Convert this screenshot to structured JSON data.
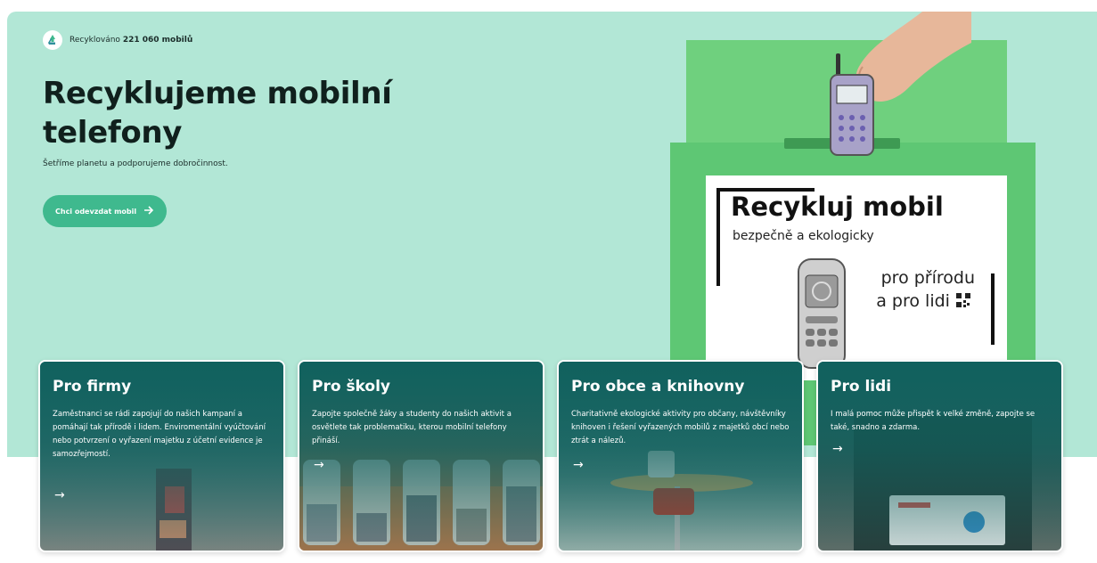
{
  "counter": {
    "prefix": "Recyklováno",
    "count": "221 060 mobilů",
    "icon": "recycle-icon"
  },
  "hero": {
    "title": "Recyklujeme mobilní telefony",
    "subtitle": "Šetříme planetu a podporujeme dobročinnost.",
    "cta_label": "Chci odevzdat mobil",
    "cta_icon": "arrow-right-icon"
  },
  "poster": {
    "title": "Recykluj mobil",
    "subtitle": "bezpečně a ekologicky",
    "line1": "pro přírodu",
    "line2": "a pro lidi"
  },
  "cards": [
    {
      "title": "Pro firmy",
      "text": "Zaměstnanci se rádi zapojují do našich kampaní a pomáhají tak přírodě i lidem. Enviromentální vyúčtování nebo potvrzení o vyřazení majetku z účetní evidence je samozřejmostí.",
      "arrow": "→"
    },
    {
      "title": "Pro školy",
      "text": "Zapojte společně žáky a studenty do našich aktivit a osvětlete tak problematiku, kterou mobilní telefony přináší.",
      "arrow": "→"
    },
    {
      "title": "Pro obce a knihovny",
      "text": "Charitativně ekologické aktivity pro občany, návštěvníky knihoven i řešení vyřazených mobilů z majetků obcí nebo ztrát a nálezů.",
      "arrow": "→"
    },
    {
      "title": "Pro lidi",
      "text": "I malá pomoc může přispět k velké změně, zapojte se také, snadno a zdarma.",
      "arrow": "→"
    }
  ],
  "colors": {
    "hero_bg": "#b2e7d6",
    "accent": "#3fb98e",
    "card_overlay": "#0e605c",
    "box_green": "#5ec774"
  }
}
